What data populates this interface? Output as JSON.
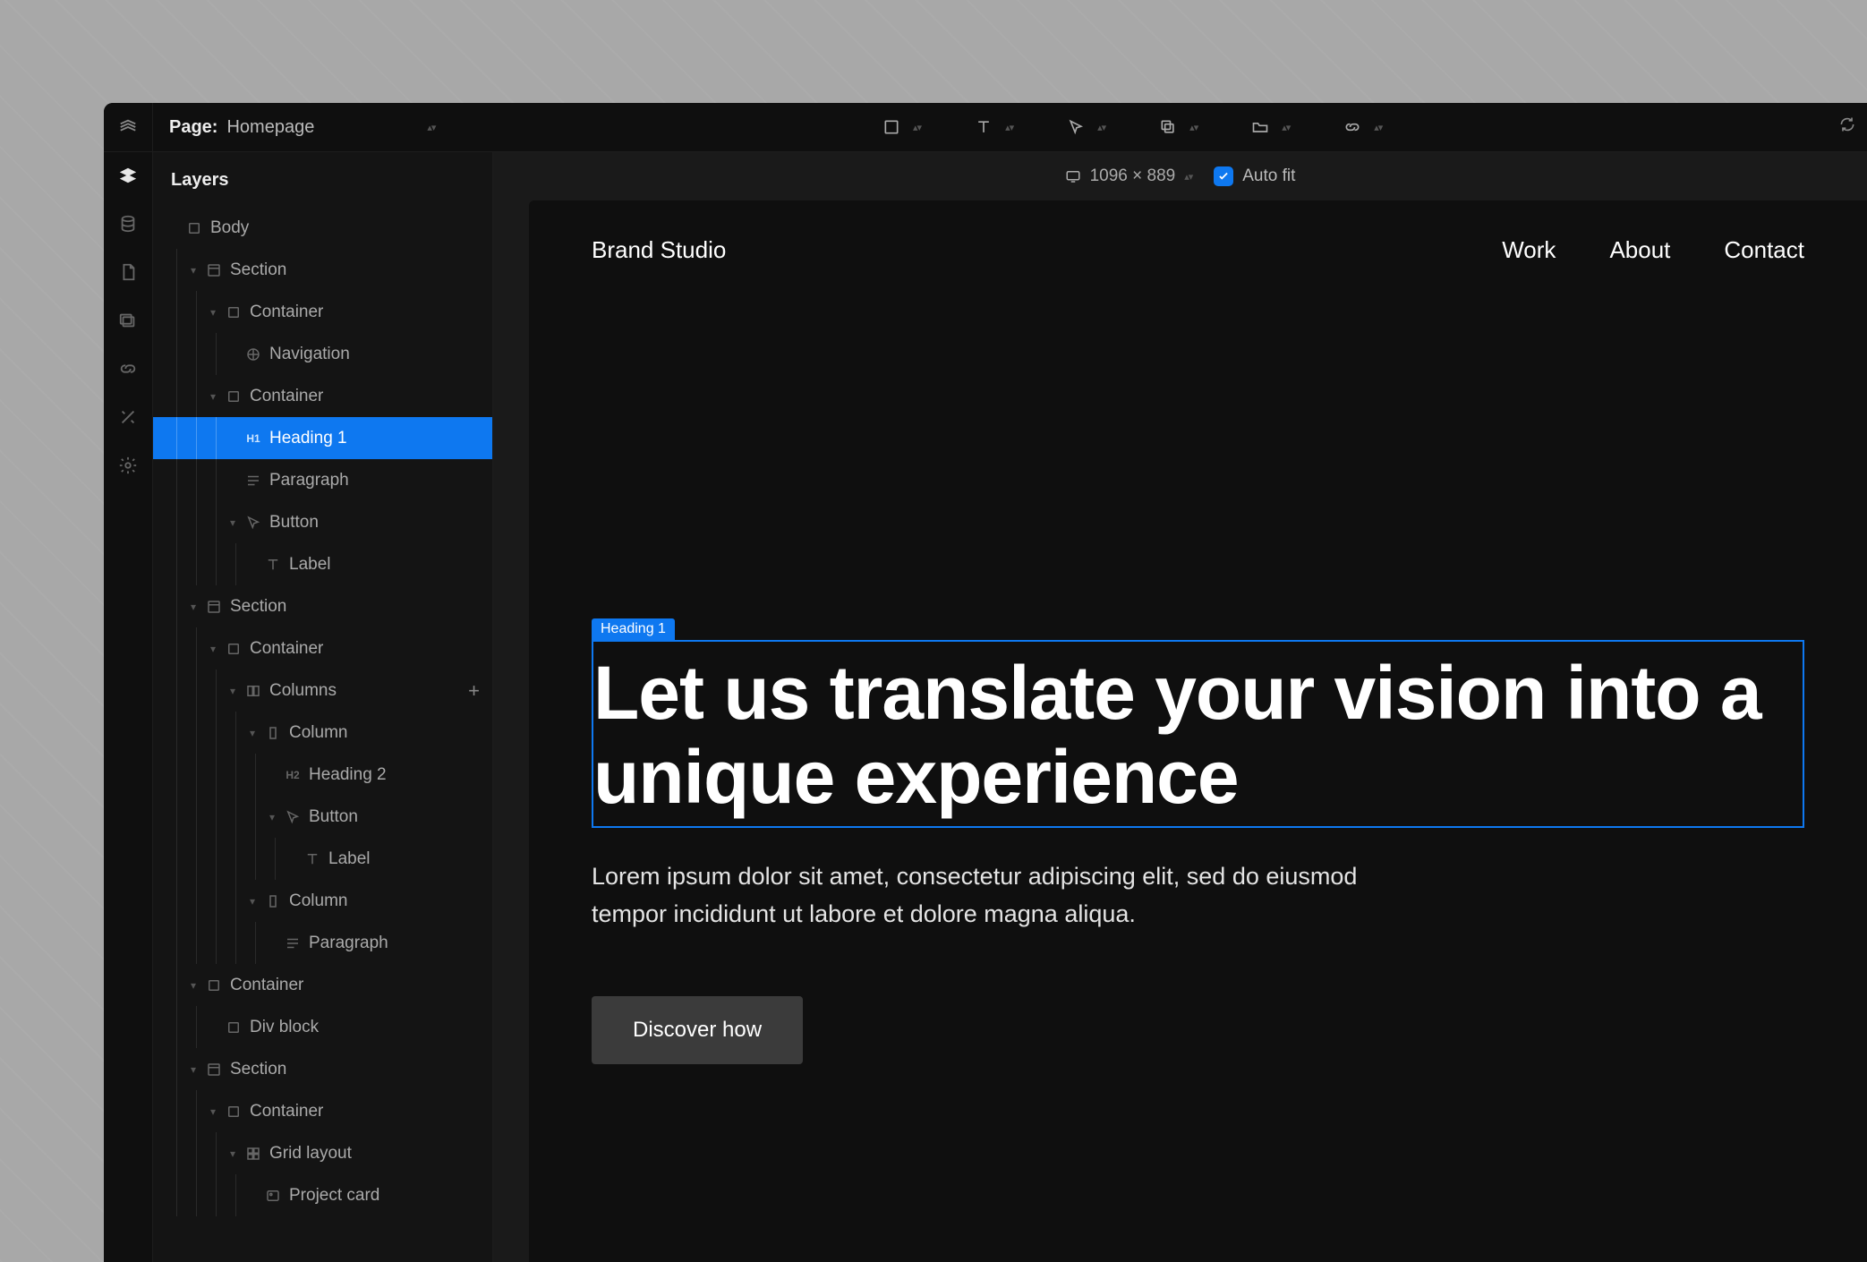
{
  "topbar": {
    "page_prefix": "Page:",
    "page_name": "Homepage"
  },
  "viewport": {
    "dimensions": "1096 × 889",
    "autofit_label": "Auto fit",
    "autofit_checked": true
  },
  "panel": {
    "title": "Layers"
  },
  "tree": [
    {
      "depth": 0,
      "twisty": "",
      "icon": "square",
      "label": "Body"
    },
    {
      "depth": 1,
      "twisty": "▾",
      "icon": "section",
      "label": "Section"
    },
    {
      "depth": 2,
      "twisty": "▾",
      "icon": "container",
      "label": "Container"
    },
    {
      "depth": 3,
      "twisty": "",
      "icon": "nav",
      "label": "Navigation"
    },
    {
      "depth": 2,
      "twisty": "▾",
      "icon": "container",
      "label": "Container"
    },
    {
      "depth": 3,
      "twisty": "",
      "icon": "h1",
      "label": "Heading 1",
      "selected": true
    },
    {
      "depth": 3,
      "twisty": "",
      "icon": "para",
      "label": "Paragraph"
    },
    {
      "depth": 3,
      "twisty": "▾",
      "icon": "cursor",
      "label": "Button"
    },
    {
      "depth": 4,
      "twisty": "",
      "icon": "text",
      "label": "Label"
    },
    {
      "depth": 1,
      "twisty": "▾",
      "icon": "section",
      "label": "Section"
    },
    {
      "depth": 2,
      "twisty": "▾",
      "icon": "container",
      "label": "Container"
    },
    {
      "depth": 3,
      "twisty": "▾",
      "icon": "columns",
      "label": "Columns",
      "action": "plus"
    },
    {
      "depth": 4,
      "twisty": "▾",
      "icon": "column",
      "label": "Column"
    },
    {
      "depth": 5,
      "twisty": "",
      "icon": "h2",
      "label": "Heading 2"
    },
    {
      "depth": 5,
      "twisty": "▾",
      "icon": "cursor",
      "label": "Button"
    },
    {
      "depth": 6,
      "twisty": "",
      "icon": "text",
      "label": "Label"
    },
    {
      "depth": 4,
      "twisty": "▾",
      "icon": "column",
      "label": "Column"
    },
    {
      "depth": 5,
      "twisty": "",
      "icon": "para",
      "label": "Paragraph"
    },
    {
      "depth": 1,
      "twisty": "▾",
      "icon": "container",
      "label": "Container"
    },
    {
      "depth": 2,
      "twisty": "",
      "icon": "square",
      "label": "Div block"
    },
    {
      "depth": 1,
      "twisty": "▾",
      "icon": "section",
      "label": "Section"
    },
    {
      "depth": 2,
      "twisty": "▾",
      "icon": "container",
      "label": "Container"
    },
    {
      "depth": 3,
      "twisty": "▾",
      "icon": "grid",
      "label": "Grid layout"
    },
    {
      "depth": 4,
      "twisty": "",
      "icon": "card",
      "label": "Project card"
    }
  ],
  "page": {
    "brand": "Brand Studio",
    "nav": [
      "Work",
      "About",
      "Contact"
    ],
    "selection_tag": "Heading 1",
    "heading": "Let us translate your vision into a unique experience",
    "paragraph": "Lorem ipsum dolor sit amet, consectetur adipiscing elit, sed do eiusmod tempor incididunt ut labore et dolore magna aliqua.",
    "cta": "Discover how"
  },
  "colors": {
    "accent": "#0e78f0"
  }
}
